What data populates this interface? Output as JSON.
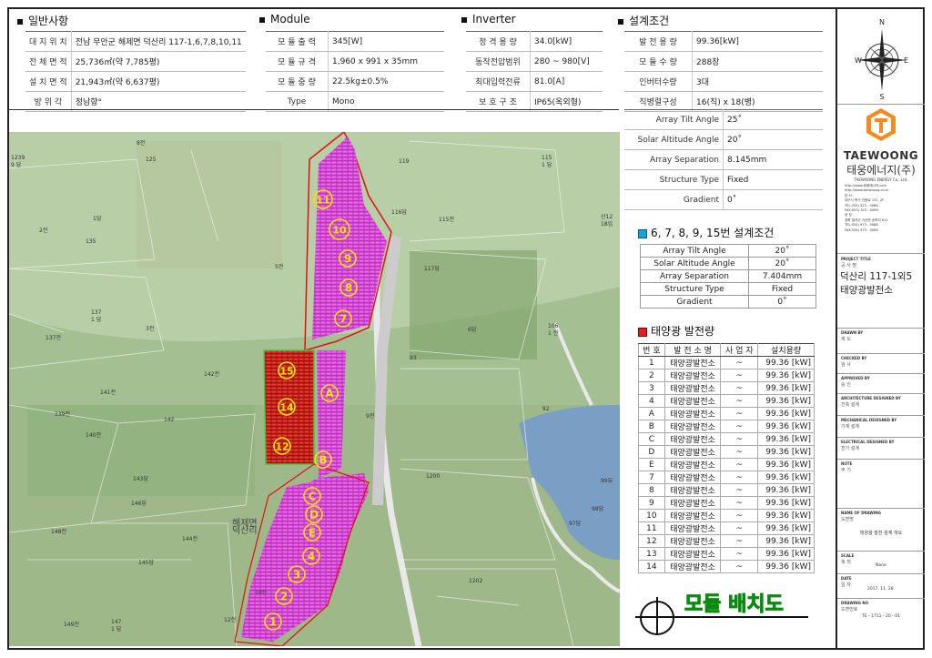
{
  "general": {
    "title": "일반사항",
    "rows": [
      {
        "key": "대 지 위 치",
        "value": "전남 무안군 해제면 덕산리 117-1,6,7,8,10,11"
      },
      {
        "key": "전 체 면 적",
        "value": "25,736㎡(약 7,785평)"
      },
      {
        "key": "설 치 면 적",
        "value": "21,943㎡(약 6,637평)"
      },
      {
        "key": "방   위   각",
        "value": "정남향°"
      }
    ]
  },
  "module": {
    "title": "Module",
    "rows": [
      {
        "key": "모 듈 출 력",
        "value": "345[W]"
      },
      {
        "key": "모 듈 규 격",
        "value": "1,960 x 991 x 35mm"
      },
      {
        "key": "모 듈 중 량",
        "value": "22.5kg±0.5%"
      },
      {
        "key": "Type",
        "value": "Mono"
      }
    ]
  },
  "inverter": {
    "title": "Inverter",
    "rows": [
      {
        "key": "정 격 용 량",
        "value": "34.0[kW]"
      },
      {
        "key": "동작전압범위",
        "value": "280 ~ 980[V]"
      },
      {
        "key": "최대입력전류",
        "value": "81.0[A]"
      },
      {
        "key": "보 호 구 조",
        "value": "IP65(옥외형)"
      }
    ]
  },
  "design": {
    "title": "설계조건",
    "rows": [
      {
        "key": "발 전 용 량",
        "value": "99.36[kW]"
      },
      {
        "key": "모 듈 수 량",
        "value": "288장"
      },
      {
        "key": "인버터수량",
        "value": "3대"
      },
      {
        "key": "직병렬구성",
        "value": "16(직) x 18(병)"
      },
      {
        "key": "Array Tilt Angle",
        "value": "25˚"
      },
      {
        "key": "Solar Altitude Angle",
        "value": "20˚"
      },
      {
        "key": "Array Separation",
        "value": "8.145mm"
      },
      {
        "key": "Structure Type",
        "value": "Fixed"
      },
      {
        "key": "Gradient",
        "value": "0˚"
      }
    ]
  },
  "design2": {
    "title": "6, 7, 8, 9, 15번 설계조건",
    "rows": [
      {
        "key": "Array Tilt Angle",
        "value": "20˚"
      },
      {
        "key": "Solar Altitude Angle",
        "value": "20˚"
      },
      {
        "key": "Array Separation",
        "value": "7.404mm"
      },
      {
        "key": "Structure Type",
        "value": "Fixed"
      },
      {
        "key": "Gradient",
        "value": "0˚"
      }
    ]
  },
  "generation": {
    "title": "태양광 발전량",
    "headers": [
      "번 호",
      "발 전 소 명",
      "사 업 자",
      "설치용량"
    ],
    "rows": [
      [
        "1",
        "태양광발전소",
        "~",
        "99.36 [kW]"
      ],
      [
        "2",
        "태양광발전소",
        "~",
        "99.36 [kW]"
      ],
      [
        "3",
        "태양광발전소",
        "~",
        "99.36 [kW]"
      ],
      [
        "4",
        "태양광발전소",
        "~",
        "99.36 [kW]"
      ],
      [
        "A",
        "태양광발전소",
        "~",
        "99.36 [kW]"
      ],
      [
        "B",
        "태양광발전소",
        "~",
        "99.36 [kW]"
      ],
      [
        "C",
        "태양광발전소",
        "~",
        "99.36 [kW]"
      ],
      [
        "D",
        "태양광발전소",
        "~",
        "99.36 [kW]"
      ],
      [
        "E",
        "태양광발전소",
        "~",
        "99.36 [kW]"
      ],
      [
        "7",
        "태양광발전소",
        "~",
        "99.36 [kW]"
      ],
      [
        "8",
        "태양광발전소",
        "~",
        "99.36 [kW]"
      ],
      [
        "9",
        "태양광발전소",
        "~",
        "99.36 [kW]"
      ],
      [
        "10",
        "태양광발전소",
        "~",
        "99.36 [kW]"
      ],
      [
        "11",
        "태양광발전소",
        "~",
        "99.36 [kW]"
      ],
      [
        "12",
        "태양광발전소",
        "~",
        "99.36 [kW]"
      ],
      [
        "13",
        "태양광발전소",
        "~",
        "99.36 [kW]"
      ],
      [
        "14",
        "태양광발전소",
        "~",
        "99.36 [kW]"
      ]
    ]
  },
  "drawing_title": "모듈 배치도",
  "compass": {
    "n": "N",
    "s": "S",
    "e": "E",
    "w": "W"
  },
  "company": {
    "logo_text": "TAEWOONG",
    "name_kr": "태웅에너지(주)",
    "name_en": "TAEWOONG ENERGY Co., Ltd.",
    "lines": [
      "http://www.태웅에너지.com",
      "http://www.taewoong.co.kr",
      "본 사 :",
      "대구시 북구 관음로 131, 2F",
      "TEL.053) 323 - 0088",
      "FAX.053) 323 - 0089",
      "공 장 :",
      "경북 칠곡군 가산면 송학리 611",
      "TEL.054) 973 - 0088",
      "FAX.054) 973 - 0089"
    ]
  },
  "title_block": {
    "project_label": "PROJECT TITLE",
    "project_sub": "공 사 명",
    "project_value": "덕산리 117-1외5 태양광발전소",
    "fields": [
      {
        "label": "DRAWN BY",
        "sub": "제 도"
      },
      {
        "label": "CHECKED BY",
        "sub": "검 사"
      },
      {
        "label": "APPROVED BY",
        "sub": "승 인"
      },
      {
        "label": "ARCHITECTURE DESIGNED BY",
        "sub": "건축 설계"
      },
      {
        "label": "MECHANICAL DESIGNED BY",
        "sub": "기계 설계"
      },
      {
        "label": "ELECTRICAL DESIGNED BY",
        "sub": "전기 설계"
      },
      {
        "label": "NOTE",
        "sub": "주 기"
      }
    ],
    "drawing_name_label": "NAME OF DRAWING",
    "drawing_name_sub": "도면명",
    "drawing_name_value": "태양광 발전 설계 개요",
    "scale_label": "SCALE",
    "scale_sub": "축 척",
    "scale_value": "None",
    "date_label": "DATE",
    "date_sub": "일 자",
    "date_value": "2017. 11. 28.",
    "drawing_no_label": "DRAWING NO",
    "drawing_no_sub": "도면번호",
    "drawing_no_value": "TE - 1711 - 20 - 01"
  },
  "map_labels": [
    "1239\n9 답",
    "125",
    "135",
    "137\n1 답",
    "137전",
    "141전",
    "139전",
    "140전",
    "142",
    "142전",
    "143답",
    "146답",
    "148전",
    "145답",
    "144전",
    "149전",
    "147\n1 답",
    "115\n1 답",
    "115전",
    "119",
    "116답",
    "117답",
    "92",
    "93",
    "99유",
    "98답",
    "97답",
    "1200",
    "1202",
    "산12\n18임",
    "106\n1 전",
    "해제면\n덕산리",
    "2전",
    "1답",
    "3전",
    "5전",
    "6답",
    "8전",
    "9전",
    "10전",
    "12전"
  ],
  "block_labels": [
    "11",
    "10",
    "9",
    "8",
    "7",
    "15",
    "14",
    "12",
    "A",
    "B",
    "C",
    "D",
    "E",
    "4",
    "3",
    "2",
    "1"
  ]
}
